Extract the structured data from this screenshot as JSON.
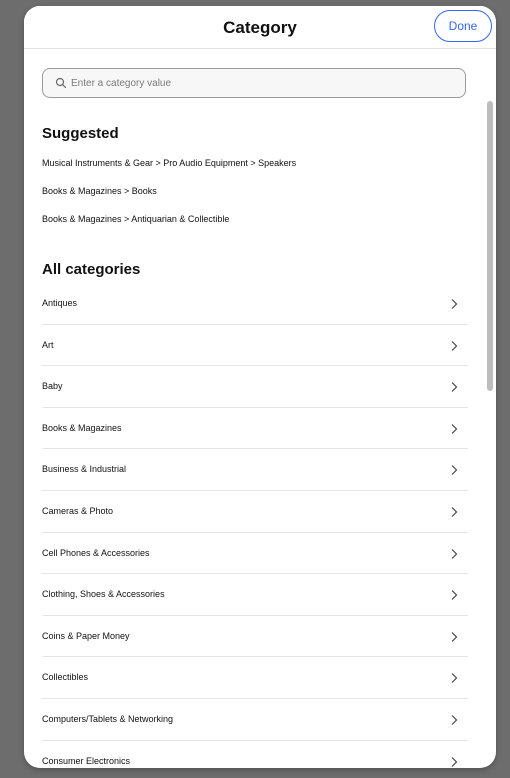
{
  "header": {
    "title": "Category",
    "done_label": "Done"
  },
  "search": {
    "placeholder": "Enter a category value",
    "value": ""
  },
  "suggested": {
    "heading": "Suggested",
    "items": [
      "Musical Instruments & Gear > Pro Audio Equipment > Speakers",
      "Books & Magazines > Books",
      "Books & Magazines > Antiquarian & Collectible"
    ]
  },
  "all_categories": {
    "heading": "All categories",
    "items": [
      "Antiques",
      "Art",
      "Baby",
      "Books & Magazines",
      "Business & Industrial",
      "Cameras & Photo",
      "Cell Phones & Accessories",
      "Clothing, Shoes & Accessories",
      "Coins & Paper Money",
      "Collectibles",
      "Computers/Tablets & Networking",
      "Consumer Electronics"
    ]
  },
  "icons": {
    "search": "search-icon",
    "chevron": "chevron-right-icon"
  },
  "colors": {
    "accent": "#3665f3",
    "backdrop": "#6d6d6d"
  }
}
